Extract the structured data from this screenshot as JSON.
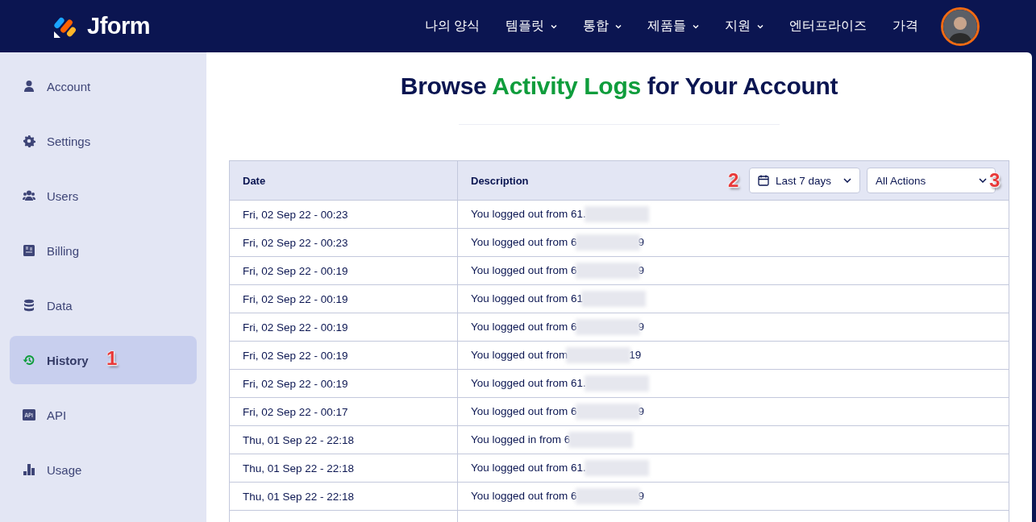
{
  "header": {
    "brand": "Jform",
    "nav": [
      {
        "label": "나의 양식",
        "dropdown": false
      },
      {
        "label": "템플릿",
        "dropdown": true
      },
      {
        "label": "통합",
        "dropdown": true
      },
      {
        "label": "제품들",
        "dropdown": true
      },
      {
        "label": "지원",
        "dropdown": true
      },
      {
        "label": "엔터프라이즈",
        "dropdown": false
      },
      {
        "label": "가격",
        "dropdown": false
      }
    ]
  },
  "sidebar": {
    "items": [
      {
        "label": "Account",
        "selected": false
      },
      {
        "label": "Settings",
        "selected": false
      },
      {
        "label": "Users",
        "selected": false
      },
      {
        "label": "Billing",
        "selected": false
      },
      {
        "label": "Data",
        "selected": false
      },
      {
        "label": "History",
        "selected": true,
        "marker": "1"
      },
      {
        "label": "API",
        "selected": false
      },
      {
        "label": "Usage",
        "selected": false
      }
    ]
  },
  "main": {
    "title": {
      "before": "Browse ",
      "highlight": "Activity Logs",
      "after": " for Your Account"
    },
    "table": {
      "columns": [
        "Date",
        "Description"
      ],
      "date_filter": {
        "value": "Last 7 days",
        "marker": "2"
      },
      "action_filter": {
        "value": "All Actions",
        "marker": "3"
      },
      "rows": [
        {
          "date": "Fri, 02 Sep 22 - 00:23",
          "description": "You logged out from 61.",
          "tail": ""
        },
        {
          "date": "Fri, 02 Sep 22 - 00:23",
          "description": "You logged out from 6",
          "tail": "9"
        },
        {
          "date": "Fri, 02 Sep 22 - 00:19",
          "description": "You logged out from 6",
          "tail": "9"
        },
        {
          "date": "Fri, 02 Sep 22 - 00:19",
          "description": "You logged out from 61",
          "tail": ""
        },
        {
          "date": "Fri, 02 Sep 22 - 00:19",
          "description": "You logged out from 6",
          "tail": "9"
        },
        {
          "date": "Fri, 02 Sep 22 - 00:19",
          "description": "You logged out from",
          "tail": "19"
        },
        {
          "date": "Fri, 02 Sep 22 - 00:19",
          "description": "You logged out from 61.",
          "tail": ""
        },
        {
          "date": "Fri, 02 Sep 22 - 00:17",
          "description": "You logged out from 6",
          "tail": "9"
        },
        {
          "date": "Thu, 01 Sep 22 - 22:18",
          "description": "You logged in from 6",
          "tail": ""
        },
        {
          "date": "Thu, 01 Sep 22 - 22:18",
          "description": "You logged out from 61.",
          "tail": ""
        },
        {
          "date": "Thu, 01 Sep 22 - 22:18",
          "description": "You logged out from 6",
          "tail": "9"
        }
      ]
    }
  }
}
